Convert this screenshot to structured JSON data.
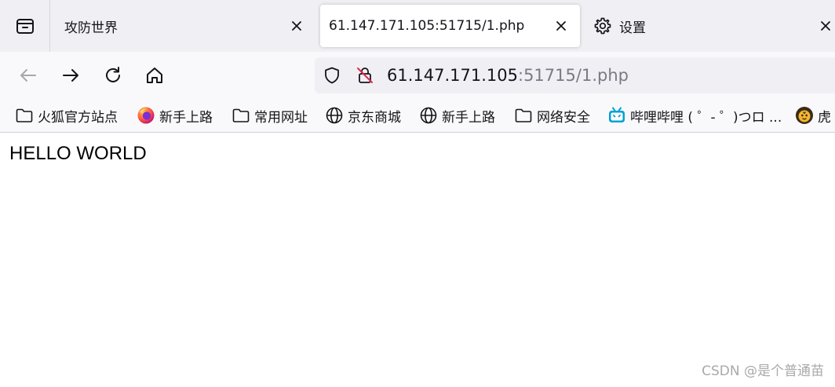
{
  "tabs": [
    {
      "label": "攻防世界",
      "active": false
    },
    {
      "label": "61.147.171.105:51715/1.php",
      "active": true
    },
    {
      "label": "设置",
      "icon": "gear-icon",
      "active": false
    }
  ],
  "urlbar": {
    "host": "61.147.171.105",
    "rest": ":51715/1.php"
  },
  "bookmarks": [
    {
      "label": "火狐官方站点",
      "icon": "folder-icon"
    },
    {
      "label": "新手上路",
      "icon": "firefox-icon"
    },
    {
      "label": "常用网址",
      "icon": "folder-icon"
    },
    {
      "label": "京东商城",
      "icon": "globe-icon"
    },
    {
      "label": "新手上路",
      "icon": "globe-icon"
    },
    {
      "label": "网络安全",
      "icon": "folder-icon"
    },
    {
      "label": "哔哩哔哩 ( ゜- ゜)つロ ...",
      "icon": "bilibili-icon"
    },
    {
      "label": "虎",
      "icon": "tiger-icon"
    }
  ],
  "page": {
    "text": "HELLO WORLD"
  },
  "watermark": "CSDN @是个普通苗",
  "colors": {
    "tabstrip": "#f0f0f4",
    "toolbar": "#f9f9fb",
    "bilibili": "#00a1d6"
  }
}
